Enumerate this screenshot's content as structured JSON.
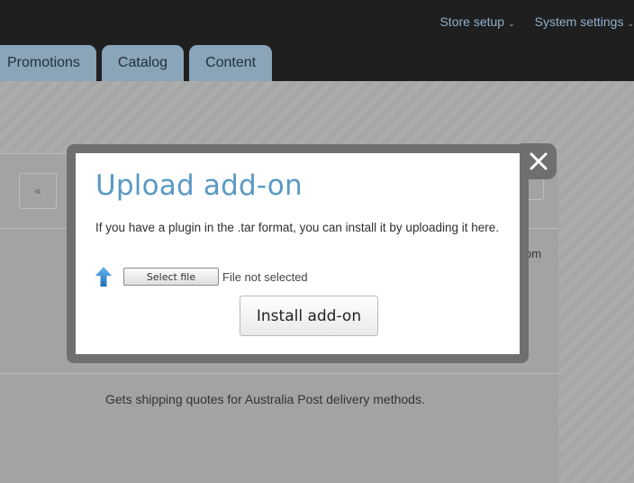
{
  "topmenu": {
    "store_setup": "Store setup",
    "system_settings": "System settings"
  },
  "tabs": [
    {
      "label": "Promotions"
    },
    {
      "label": "Catalog"
    },
    {
      "label": "Content"
    }
  ],
  "background": {
    "pager_prev": "«",
    "cut_text": "om",
    "addon_description": "Gets shipping quotes for Australia Post delivery methods."
  },
  "modal": {
    "title": "Upload add-on",
    "text": "If you have a plugin in the .tar format, you can install it by uploading it here.",
    "select_file_label": "Select file",
    "file_status": "File not selected",
    "install_label": "Install add-on"
  },
  "colors": {
    "accent": "#5a99c4",
    "topbar": "#1f1f1f",
    "tab": "#8aa4b8",
    "overlay_frame": "#6f6f6f"
  }
}
